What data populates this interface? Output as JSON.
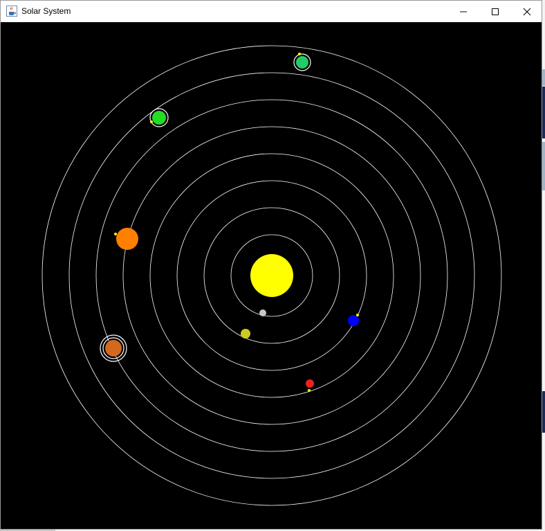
{
  "window": {
    "title": "Solar System",
    "icon": "java-cup-icon"
  },
  "controls": {
    "minimize_icon": "minimize-icon",
    "maximize_icon": "maximize-icon",
    "close_icon": "close-icon"
  },
  "scene": {
    "background_color": "#000000",
    "orbit_color": "#ffffff",
    "moon_color": "#ffff00",
    "sun": {
      "color": "#ffff00"
    },
    "planets": [
      {
        "name": "planet-1",
        "color": "#c8c8c8"
      },
      {
        "name": "planet-2",
        "color": "#cccc22"
      },
      {
        "name": "planet-3",
        "color": "#0000ff"
      },
      {
        "name": "planet-4",
        "color": "#ee2222"
      },
      {
        "name": "planet-5",
        "color": "#ff7f00"
      },
      {
        "name": "planet-6",
        "color": "#d2691e"
      },
      {
        "name": "planet-7",
        "color": "#22dd22"
      },
      {
        "name": "planet-8",
        "color": "#22cc66"
      }
    ]
  }
}
